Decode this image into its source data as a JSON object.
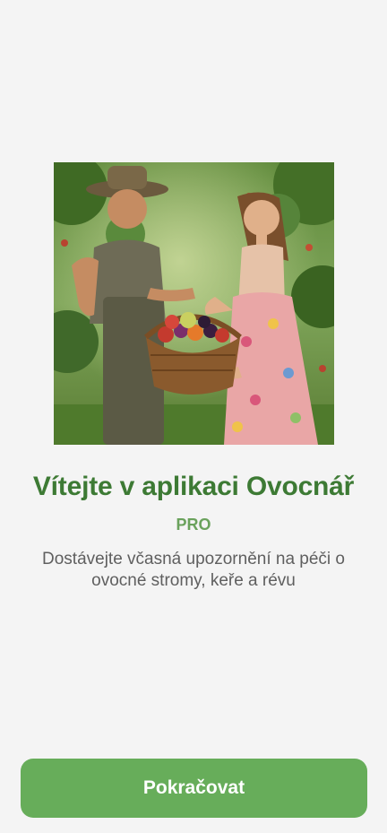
{
  "welcome": {
    "title": "Vítejte v aplikaci Ovocnář",
    "badge": "PRO",
    "subtitle": "Dostávejte včasná upozornění na péči o ovocné stromy, keře a révu"
  },
  "actions": {
    "continue_label": "Pokračovat"
  },
  "colors": {
    "title": "#3d7a34",
    "badge": "#6aa25c",
    "button": "#67ad5a",
    "background": "#f4f4f4"
  }
}
